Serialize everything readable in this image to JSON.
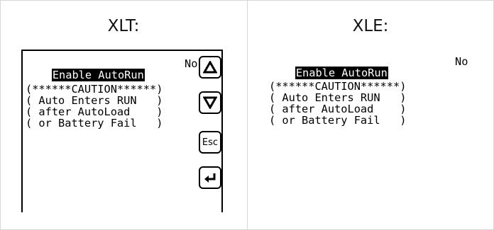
{
  "columns": {
    "xlt": {
      "title": "XLT:"
    },
    "xle": {
      "title": "XLE:"
    }
  },
  "screen": {
    "setting_label": "Enable AutoRun",
    "setting_value": "No",
    "lines": [
      "(******CAUTION******)",
      "( Auto Enters RUN   )",
      "( after AutoLoad    )",
      "( or Battery Fail   )"
    ]
  },
  "xlt_buttons": {
    "up": "up-arrow-icon",
    "down": "down-arrow-icon",
    "esc_label": "Esc",
    "enter": "enter-arrow-icon"
  }
}
